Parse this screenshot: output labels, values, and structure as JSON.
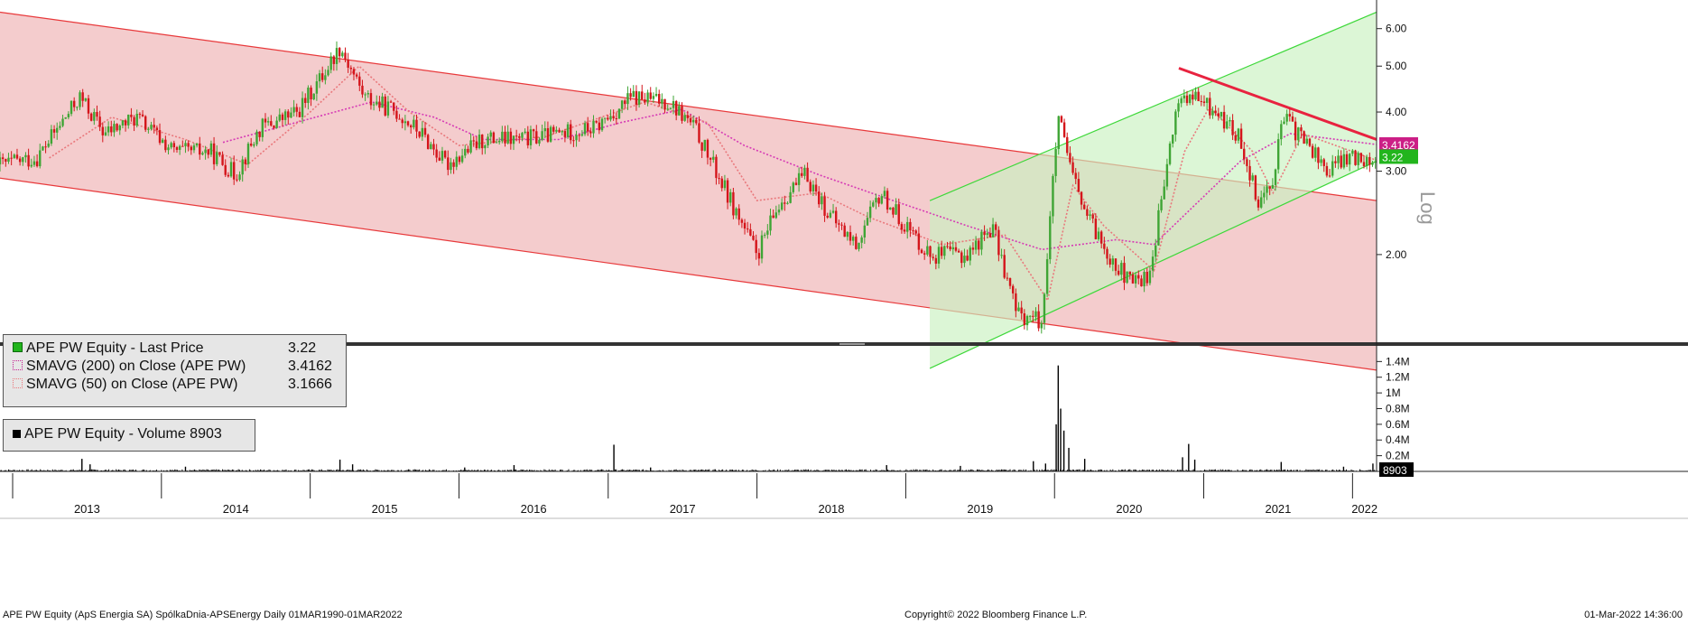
{
  "colors": {
    "background": "#ffffff",
    "down_channel_fill": "#f4cccd",
    "down_channel_line": "#e8393b",
    "up_channel_fill": "#c9f1c0",
    "up_channel_line": "#3ed83a",
    "resistance_line": "#e8233f",
    "candle_up": "#3fa535",
    "candle_down": "#d4151b",
    "sma200": "#d63bb5",
    "sma50": "#e9787c",
    "volume": "#000000",
    "last_price_tag": "#22b51d",
    "sma200_tag": "#cc1f86"
  },
  "chart_data": [
    {
      "type": "candlestick",
      "title": "",
      "scale": "log",
      "scale_label": "Log",
      "ylim": [
        1.3,
        6.6
      ],
      "y_ticks": [
        "2.00",
        "3.00",
        "4.00",
        "5.00",
        "6.00"
      ],
      "y_tick_values": [
        2,
        3,
        4,
        5,
        6
      ],
      "x_range": [
        "2012-12-01",
        "2022-03-01"
      ],
      "x_tick_labels": [
        "2013",
        "2014",
        "2015",
        "2016",
        "2017",
        "2018",
        "2019",
        "2020",
        "2021",
        "2022"
      ],
      "x_tick_dates": [
        "2013-01-01",
        "2014-01-01",
        "2015-01-01",
        "2016-01-01",
        "2017-01-01",
        "2018-01-01",
        "2019-01-01",
        "2020-01-01",
        "2021-01-01",
        "2022-01-01"
      ],
      "last_price": "3.22",
      "sma200_last": "3.4162",
      "series": [
        {
          "name": "APE PW Equity - Last Price",
          "value": "3.22",
          "legend_marker": "green-box"
        },
        {
          "name": "SMAVG (200)  on Close (APE PW)",
          "value": "3.4162",
          "legend_marker": "magenta-dotted"
        },
        {
          "name": "SMAVG (50)  on Close (APE PW)",
          "value": "3.1666",
          "legend_marker": "pink-dotted"
        }
      ],
      "price_path": [
        [
          "2012-12-01",
          3.1
        ],
        [
          "2013-03-01",
          3.2
        ],
        [
          "2013-06-15",
          4.3
        ],
        [
          "2013-08-15",
          3.6
        ],
        [
          "2013-11-01",
          3.9
        ],
        [
          "2014-02-01",
          3.3
        ],
        [
          "2014-05-01",
          3.3
        ],
        [
          "2014-07-01",
          2.95
        ],
        [
          "2014-09-01",
          3.7
        ],
        [
          "2014-12-01",
          4.0
        ],
        [
          "2015-02-01",
          4.8
        ],
        [
          "2015-03-15",
          5.5
        ],
        [
          "2015-05-15",
          4.3
        ],
        [
          "2015-08-01",
          4.0
        ],
        [
          "2015-10-01",
          3.6
        ],
        [
          "2015-12-01",
          3.1
        ],
        [
          "2016-03-01",
          3.5
        ],
        [
          "2016-06-01",
          3.5
        ],
        [
          "2016-09-01",
          3.6
        ],
        [
          "2016-12-01",
          3.7
        ],
        [
          "2017-03-01",
          4.3
        ],
        [
          "2017-06-01",
          4.2
        ],
        [
          "2017-08-01",
          3.7
        ],
        [
          "2017-10-01",
          2.9
        ],
        [
          "2018-01-01",
          2.0
        ],
        [
          "2018-03-01",
          2.6
        ],
        [
          "2018-05-01",
          2.95
        ],
        [
          "2018-07-01",
          2.4
        ],
        [
          "2018-09-01",
          2.1
        ],
        [
          "2018-11-01",
          2.7
        ],
        [
          "2019-01-01",
          2.3
        ],
        [
          "2019-03-01",
          2.0
        ],
        [
          "2019-06-01",
          2.0
        ],
        [
          "2019-08-01",
          2.3
        ],
        [
          "2019-10-01",
          1.5
        ],
        [
          "2019-12-01",
          1.45
        ],
        [
          "2020-01-10",
          3.9
        ],
        [
          "2020-02-10",
          3.0
        ],
        [
          "2020-03-20",
          2.4
        ],
        [
          "2020-05-15",
          2.0
        ],
        [
          "2020-07-01",
          1.75
        ],
        [
          "2020-08-20",
          1.8
        ],
        [
          "2020-10-01",
          3.0
        ],
        [
          "2020-11-01",
          4.3
        ],
        [
          "2020-12-15",
          4.25
        ],
        [
          "2021-02-01",
          4.0
        ],
        [
          "2021-04-01",
          3.5
        ],
        [
          "2021-05-15",
          2.6
        ],
        [
          "2021-06-15",
          2.8
        ],
        [
          "2021-07-15",
          3.9
        ],
        [
          "2021-09-15",
          3.4
        ],
        [
          "2021-11-01",
          3.0
        ],
        [
          "2021-12-15",
          3.2
        ],
        [
          "2022-02-28",
          3.22
        ]
      ],
      "sma200_path": [
        [
          "2014-06-01",
          3.45
        ],
        [
          "2015-06-01",
          4.2
        ],
        [
          "2015-11-01",
          3.9
        ],
        [
          "2016-03-01",
          3.5
        ],
        [
          "2016-09-01",
          3.5
        ],
        [
          "2017-02-01",
          3.8
        ],
        [
          "2017-07-01",
          4.05
        ],
        [
          "2017-12-01",
          3.4
        ],
        [
          "2018-06-01",
          2.95
        ],
        [
          "2018-12-01",
          2.6
        ],
        [
          "2019-06-01",
          2.3
        ],
        [
          "2019-12-01",
          2.05
        ],
        [
          "2020-06-01",
          2.15
        ],
        [
          "2020-09-01",
          2.1
        ],
        [
          "2020-12-01",
          2.5
        ],
        [
          "2021-04-01",
          3.15
        ],
        [
          "2021-08-01",
          3.6
        ],
        [
          "2022-02-28",
          3.4162
        ]
      ],
      "sma50_path": [
        [
          "2013-04-01",
          3.2
        ],
        [
          "2013-09-01",
          3.9
        ],
        [
          "2014-03-01",
          3.5
        ],
        [
          "2014-08-01",
          3.1
        ],
        [
          "2015-01-01",
          4.0
        ],
        [
          "2015-05-01",
          5.0
        ],
        [
          "2015-09-01",
          4.0
        ],
        [
          "2016-01-01",
          3.4
        ],
        [
          "2016-08-01",
          3.55
        ],
        [
          "2017-04-01",
          4.2
        ],
        [
          "2017-09-01",
          3.8
        ],
        [
          "2018-01-01",
          2.6
        ],
        [
          "2018-06-01",
          2.7
        ],
        [
          "2018-10-01",
          2.4
        ],
        [
          "2019-04-01",
          2.1
        ],
        [
          "2019-09-01",
          2.2
        ],
        [
          "2019-12-15",
          1.6
        ],
        [
          "2020-02-15",
          2.8
        ],
        [
          "2020-05-01",
          2.3
        ],
        [
          "2020-09-01",
          1.85
        ],
        [
          "2020-11-15",
          3.3
        ],
        [
          "2021-01-15",
          4.1
        ],
        [
          "2021-05-01",
          3.3
        ],
        [
          "2021-06-20",
          2.7
        ],
        [
          "2021-09-01",
          3.6
        ],
        [
          "2022-02-28",
          3.1666
        ]
      ],
      "down_channel": {
        "upper": [
          [
            "2012-12-01",
            6.5
          ],
          [
            "2022-03-01",
            2.6
          ]
        ],
        "lower": [
          [
            "2012-12-01",
            2.9
          ],
          [
            "2022-03-01",
            1.14
          ]
        ]
      },
      "up_channel": {
        "upper": [
          [
            "2019-03-01",
            2.6
          ],
          [
            "2022-03-01",
            6.5
          ]
        ],
        "lower": [
          [
            "2019-03-01",
            1.15
          ],
          [
            "2022-03-01",
            3.15
          ]
        ]
      },
      "resistance_line": [
        [
          "2020-11-01",
          4.95
        ],
        [
          "2022-03-01",
          3.5
        ]
      ]
    },
    {
      "type": "bar",
      "title": "",
      "name": "APE PW Equity - Volume",
      "last_value": "8903",
      "ylim": [
        0,
        1450000
      ],
      "y_ticks": [
        "0.2M",
        "0.4M",
        "0.6M",
        "0.8M",
        "1M",
        "1.2M",
        "1.4M"
      ],
      "y_tick_values": [
        200000,
        400000,
        600000,
        800000,
        1000000,
        1200000,
        1400000
      ],
      "spikes": [
        [
          "2013-06-20",
          160000
        ],
        [
          "2013-07-10",
          90000
        ],
        [
          "2014-03-01",
          60000
        ],
        [
          "2015-03-15",
          150000
        ],
        [
          "2015-04-15",
          90000
        ],
        [
          "2016-01-15",
          50000
        ],
        [
          "2016-05-15",
          80000
        ],
        [
          "2017-01-15",
          340000
        ],
        [
          "2017-04-15",
          50000
        ],
        [
          "2018-11-15",
          80000
        ],
        [
          "2019-05-15",
          70000
        ],
        [
          "2019-11-10",
          130000
        ],
        [
          "2019-12-10",
          100000
        ],
        [
          "2020-01-05",
          600000
        ],
        [
          "2020-01-10",
          1350000
        ],
        [
          "2020-01-16",
          800000
        ],
        [
          "2020-01-24",
          520000
        ],
        [
          "2020-02-05",
          300000
        ],
        [
          "2020-03-15",
          160000
        ],
        [
          "2020-11-10",
          180000
        ],
        [
          "2020-11-25",
          350000
        ],
        [
          "2020-12-10",
          150000
        ],
        [
          "2021-07-10",
          120000
        ],
        [
          "2021-12-10",
          60000
        ],
        [
          "2022-02-20",
          100000
        ]
      ]
    }
  ],
  "legend": {
    "volume_label": "APE PW Equity - Volume 8903"
  },
  "footer": {
    "left": "APE PW Equity (ApS Energia SA) SpólkaDnia-APSEnergy  Daily 01MAR1990-01MAR2022",
    "center": "Copyright© 2022 Bloomberg Finance L.P.",
    "right": "01-Mar-2022 14:36:00"
  }
}
